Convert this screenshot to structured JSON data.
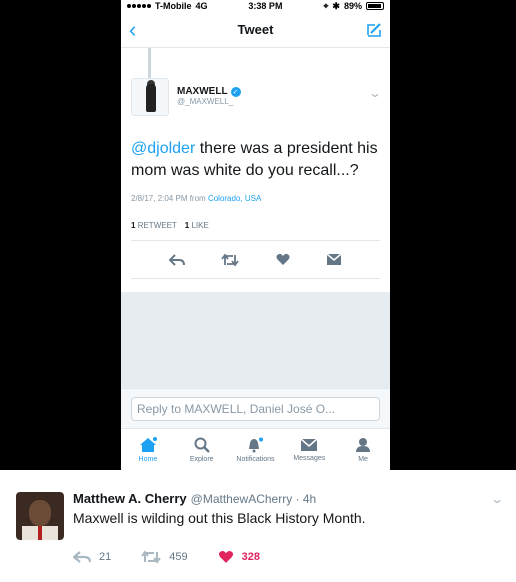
{
  "status": {
    "carrier": "T-Mobile",
    "network": "4G",
    "time": "3:38 PM",
    "battery": "89%"
  },
  "nav": {
    "title": "Tweet"
  },
  "tweet": {
    "name": "MAXWELL",
    "handle": "@_MAXWELL_",
    "mention": "@djolder",
    "text": " there was a president his mom was white do you recall...?",
    "date": "2/8/17, 2:04 PM from",
    "location": "Colorado, USA",
    "retweets_count": "1",
    "retweets_label": "RETWEET",
    "likes_count": "1",
    "likes_label": "LIKE"
  },
  "reply": {
    "placeholder": "Reply to MAXWELL, Daniel José O..."
  },
  "tabs": [
    {
      "label": "Home",
      "icon": "home-icon"
    },
    {
      "label": "Explore",
      "icon": "search-icon"
    },
    {
      "label": "Notifications",
      "icon": "bell-icon"
    },
    {
      "label": "Messages",
      "icon": "envelope-icon"
    },
    {
      "label": "Me",
      "icon": "person-icon"
    }
  ],
  "embed": {
    "name": "Matthew A. Cherry",
    "handle": "@MatthewACherry · 4h",
    "text": "Maxwell is wilding out this Black History Month.",
    "replies": "21",
    "retweets": "459",
    "likes": "328"
  },
  "colors": {
    "accent": "#1da1f2",
    "like": "#e0245e",
    "muted": "#657786"
  }
}
